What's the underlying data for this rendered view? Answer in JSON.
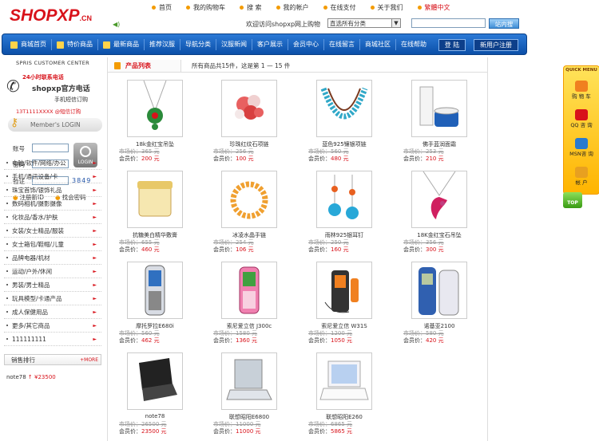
{
  "logo": {
    "main": "SHOPXP",
    "suffix": ".CN"
  },
  "topnav": [
    {
      "label": "首页",
      "red": false
    },
    {
      "label": "我的购物车",
      "red": false
    },
    {
      "label": "搜 索",
      "red": false
    },
    {
      "label": "我的帐户",
      "red": false
    },
    {
      "label": "在线支付",
      "red": false
    },
    {
      "label": "关于我们",
      "red": false
    },
    {
      "label": "繁體中文",
      "red": true
    }
  ],
  "welcome": "欢迎访问shopxp网上购物",
  "search": {
    "category": "直选所有分类",
    "button": "站内搜"
  },
  "mainnav": [
    "商城首页",
    "特价商品",
    "最新商品",
    "推荐汉服",
    "导航分类",
    "汉服新闻",
    "客户展示",
    "会员中心",
    "在线留言",
    "商城社区",
    "在线帮助"
  ],
  "nav_buttons": {
    "login": "登 陆",
    "register": "新用户注册"
  },
  "sidebar": {
    "service_title": "SPRIS CUSTOMER CENTER",
    "hotline_label": "24小时联系电话",
    "company_phone": "shopxp官方电话",
    "sms_label": "手机短信订购",
    "sms_number": "13T1111XXXX  @短信订购",
    "member_login": "Member's LOGIN",
    "account_label": "账号",
    "password_label": "密码",
    "verify_label": "验证",
    "captcha": "3849",
    "login_img": "LOGIN",
    "register_link": "注册新ID",
    "forgot_link": "找会密码",
    "categories": [
      "电脑/软件/网络/办公",
      "手机/通讯设备/卡",
      "珠宝首饰/银饰礼品",
      "数码相机/摄影摄像",
      "化妆品/香水/护肤",
      "女装/女士精品/服装",
      "女士箱包/鞋帽/儿童",
      "品牌电器/机材",
      "运动/户外/休闲",
      "男装/男士精品",
      "玩具模型/卡通产品",
      "成人保健用品",
      "更多/其它商品",
      "111111111"
    ],
    "rank_title": "销售排行",
    "rank_more": "+MORE",
    "rank_item": {
      "name": "note78",
      "price": "↑ ¥23500"
    }
  },
  "content": {
    "title": "产品列表",
    "info": "所有商品共15件，这是第 1 — 15 件"
  },
  "product_labels": {
    "market": "市场价：",
    "member": "会员价："
  },
  "products": [
    {
      "name": "18k金红宝吊坠",
      "market": "365 元",
      "member": "200 元",
      "kind": "pendant-green"
    },
    {
      "name": "珍珠红纹石项链",
      "market": "256 元",
      "member": "100 元",
      "kind": "pearl-red"
    },
    {
      "name": "蓝色925镶银项链",
      "market": "560 元",
      "member": "480 元",
      "kind": "turquoise"
    },
    {
      "name": "佛手蓝润面霜",
      "market": "253 元",
      "member": "210 元",
      "kind": "cosmetic"
    },
    {
      "name": "抗糖美白精华敷膏",
      "market": "655 元",
      "member": "460 元",
      "kind": "cream"
    },
    {
      "name": "冰凌水晶手链",
      "market": "254 元",
      "member": "106 元",
      "kind": "bracelet"
    },
    {
      "name": "雨林925银耳钉",
      "market": "250 元",
      "member": "160 元",
      "kind": "earring"
    },
    {
      "name": "18K金红宝石吊坠",
      "market": "356 元",
      "member": "300 元",
      "kind": "pendant-red"
    },
    {
      "name": "摩托罗拉E680i",
      "market": "560 元",
      "member": "462 元",
      "kind": "phone-silver"
    },
    {
      "name": "索尼爱立信 J300c",
      "market": "1580 元",
      "member": "1360 元",
      "kind": "phone-pink"
    },
    {
      "name": "索尼爱立信 W31S",
      "market": "1200 元",
      "member": "1050 元",
      "kind": "phone-orange"
    },
    {
      "name": "诺基亚2100",
      "market": "580 元",
      "member": "420 元",
      "kind": "phone-blue"
    },
    {
      "name": "note78",
      "market": "26500 元",
      "member": "23500 元",
      "kind": "laptop-black"
    },
    {
      "name": "联想昭阳E6800",
      "market": "11000 元",
      "member": "11000 元",
      "kind": "laptop-silver"
    },
    {
      "name": "联想昭阳E260",
      "market": "6865 元",
      "member": "5865 元",
      "kind": "laptop-white"
    }
  ],
  "rightbar": [
    {
      "label": "购 物 车"
    },
    {
      "label": "QQ 咨 询"
    },
    {
      "label": "MSN咨 询"
    },
    {
      "label": "帐 户"
    }
  ],
  "rightbar_top": "QUICK MENU",
  "top_button": "TOP"
}
